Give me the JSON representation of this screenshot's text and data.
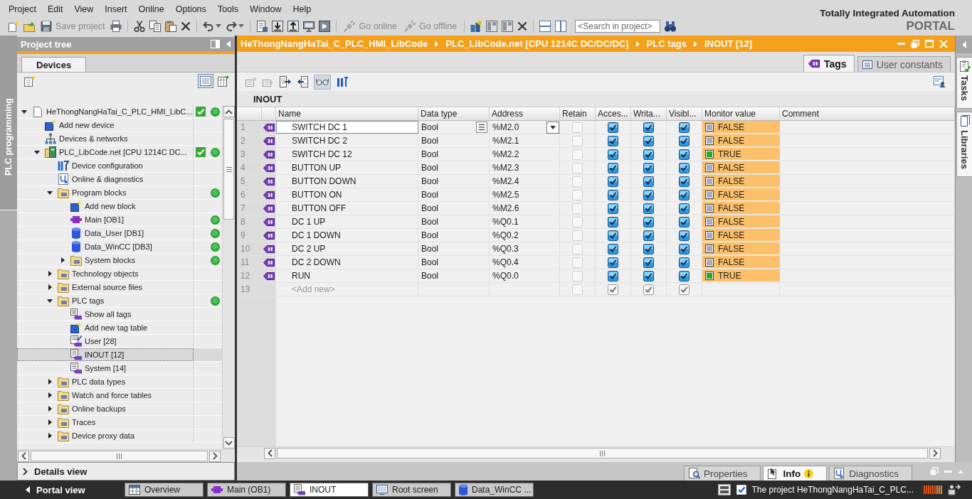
{
  "menu_bar": {
    "items": [
      "Project",
      "Edit",
      "View",
      "Insert",
      "Online",
      "Options",
      "Tools",
      "Window",
      "Help"
    ]
  },
  "toolbar": {
    "buttons": [
      {
        "label": "Save project",
        "disabled": true
      },
      {
        "label": "Go online",
        "disabled": true
      },
      {
        "label": "Go offline",
        "disabled": true
      }
    ],
    "search": {
      "placeholder": "<Search in project>"
    }
  },
  "branding": {
    "title": "Totally Integrated Automation",
    "product": "PORTAL"
  },
  "side_tab": {
    "label": "PLC programming"
  },
  "project_tree": {
    "title": "Project tree",
    "tabs": [
      {
        "label": "Devices",
        "selected": true
      }
    ],
    "toggle_pressed": true,
    "items": [
      {
        "label": "HeThongNangHaTai_C_PLC_HMI_LibC...",
        "kind": "project",
        "expanded": true,
        "consistent": true,
        "online_ok": true,
        "selected": false,
        "children": [
          {
            "label": "Add new device",
            "kind": "add",
            "consistent": false,
            "online_ok": false,
            "selected": false
          },
          {
            "label": "Devices & networks",
            "kind": "network",
            "consistent": false,
            "online_ok": false,
            "selected": false
          },
          {
            "label": "PLC_LibCode.net [CPU 1214C DC...",
            "kind": "plc",
            "expanded": true,
            "consistent": true,
            "online_ok": true,
            "selected": false,
            "children": [
              {
                "label": "Device configuration",
                "kind": "config",
                "consistent": false,
                "online_ok": false,
                "selected": false
              },
              {
                "label": "Online & diagnostics",
                "kind": "diagnostics",
                "consistent": false,
                "online_ok": false,
                "selected": false
              },
              {
                "label": "Program blocks",
                "kind": "folder",
                "expanded": true,
                "consistent": false,
                "online_ok": true,
                "selected": false,
                "children": [
                  {
                    "label": "Add new block",
                    "kind": "add",
                    "consistent": false,
                    "online_ok": false,
                    "selected": false
                  },
                  {
                    "label": "Main [OB1]",
                    "kind": "ob",
                    "consistent": false,
                    "online_ok": true,
                    "selected": false
                  },
                  {
                    "label": "Data_User [DB1]",
                    "kind": "db",
                    "consistent": false,
                    "online_ok": true,
                    "selected": false
                  },
                  {
                    "label": "Data_WinCC [DB3]",
                    "kind": "db",
                    "consistent": false,
                    "online_ok": true,
                    "selected": false
                  },
                  {
                    "label": "System blocks",
                    "kind": "folder",
                    "expanded": false,
                    "consistent": false,
                    "online_ok": true,
                    "selected": false
                  }
                ]
              },
              {
                "label": "Technology objects",
                "kind": "folder",
                "expanded": false,
                "consistent": false,
                "online_ok": false,
                "selected": false
              },
              {
                "label": "External source files",
                "kind": "folder",
                "expanded": false,
                "consistent": false,
                "online_ok": false,
                "selected": false
              },
              {
                "label": "PLC tags",
                "kind": "folder",
                "expanded": true,
                "consistent": false,
                "online_ok": true,
                "selected": false,
                "children": [
                  {
                    "label": "Show all tags",
                    "kind": "showtags",
                    "consistent": false,
                    "online_ok": false,
                    "selected": false
                  },
                  {
                    "label": "Add new tag table",
                    "kind": "add",
                    "consistent": false,
                    "online_ok": false,
                    "selected": false
                  },
                  {
                    "label": "User [28]",
                    "kind": "usertable",
                    "consistent": false,
                    "online_ok": false,
                    "selected": false
                  },
                  {
                    "label": "INOUT [12]",
                    "kind": "tagtable",
                    "consistent": false,
                    "online_ok": false,
                    "selected": true
                  },
                  {
                    "label": "System [14]",
                    "kind": "tagtable",
                    "consistent": false,
                    "online_ok": false,
                    "selected": false
                  }
                ]
              },
              {
                "label": "PLC data types",
                "kind": "folder",
                "expanded": false,
                "consistent": false,
                "online_ok": false,
                "selected": false
              },
              {
                "label": "Watch and force tables",
                "kind": "folder",
                "expanded": false,
                "consistent": false,
                "online_ok": false,
                "selected": false
              },
              {
                "label": "Online backups",
                "kind": "folder",
                "expanded": false,
                "consistent": false,
                "online_ok": false,
                "selected": false
              },
              {
                "label": "Traces",
                "kind": "folder",
                "expanded": false,
                "consistent": false,
                "online_ok": false,
                "selected": false
              },
              {
                "label": "Device proxy data",
                "kind": "folder",
                "expanded": false,
                "consistent": false,
                "online_ok": false,
                "selected": false
              }
            ]
          }
        ]
      }
    ]
  },
  "editor": {
    "breadcrumb": [
      "HeThongNangHaTai_C_PLC_HMI_LibCode",
      "PLC_LibCode.net [CPU 1214C DC/DC/DC]",
      "PLC tags",
      "INOUT [12]"
    ],
    "tabs": [
      {
        "label": "Tags",
        "kind": "tags",
        "selected": true
      },
      {
        "label": "User constants",
        "kind": "constants",
        "selected": false
      }
    ],
    "monitoring": true,
    "table_title": "INOUT",
    "columns": [
      "Name",
      "Data type",
      "Address",
      "Retain",
      "Acces...",
      "Writa...",
      "Visibl...",
      "Monitor value",
      "Comment"
    ],
    "rows": [
      {
        "number": "1",
        "name": "SWITCH DC 1",
        "data_type": "Bool",
        "address": "%M2.0",
        "retain": false,
        "accessible": true,
        "writable": true,
        "visible": true,
        "monitor_value": "FALSE",
        "signal": false,
        "focused": true
      },
      {
        "number": "2",
        "name": "SWITCH DC 2",
        "data_type": "Bool",
        "address": "%M2.1",
        "retain": false,
        "accessible": true,
        "writable": true,
        "visible": true,
        "monitor_value": "FALSE",
        "signal": false,
        "focused": false
      },
      {
        "number": "3",
        "name": "SWITCH DC 12",
        "data_type": "Bool",
        "address": "%M2.2",
        "retain": false,
        "accessible": true,
        "writable": true,
        "visible": true,
        "monitor_value": "TRUE",
        "signal": true,
        "focused": false
      },
      {
        "number": "4",
        "name": "BUTTON UP",
        "data_type": "Bool",
        "address": "%M2.3",
        "retain": false,
        "accessible": true,
        "writable": true,
        "visible": true,
        "monitor_value": "FALSE",
        "signal": false,
        "focused": false
      },
      {
        "number": "5",
        "name": "BUTTON DOWN",
        "data_type": "Bool",
        "address": "%M2.4",
        "retain": false,
        "accessible": true,
        "writable": true,
        "visible": true,
        "monitor_value": "FALSE",
        "signal": false,
        "focused": false
      },
      {
        "number": "6",
        "name": "BUTTON ON",
        "data_type": "Bool",
        "address": "%M2.5",
        "retain": false,
        "accessible": true,
        "writable": true,
        "visible": true,
        "monitor_value": "FALSE",
        "signal": false,
        "focused": false
      },
      {
        "number": "7",
        "name": "BUTTON OFF",
        "data_type": "Bool",
        "address": "%M2.6",
        "retain": false,
        "accessible": true,
        "writable": true,
        "visible": true,
        "monitor_value": "FALSE",
        "signal": false,
        "focused": false
      },
      {
        "number": "8",
        "name": "DC 1 UP",
        "data_type": "Bool",
        "address": "%Q0.1",
        "retain": false,
        "accessible": true,
        "writable": true,
        "visible": true,
        "monitor_value": "FALSE",
        "signal": false,
        "focused": false
      },
      {
        "number": "9",
        "name": "DC 1 DOWN",
        "data_type": "Bool",
        "address": "%Q0.2",
        "retain": false,
        "accessible": true,
        "writable": true,
        "visible": true,
        "monitor_value": "FALSE",
        "signal": false,
        "focused": false
      },
      {
        "number": "10",
        "name": "DC 2 UP",
        "data_type": "Bool",
        "address": "%Q0.3",
        "retain": false,
        "accessible": true,
        "writable": true,
        "visible": true,
        "monitor_value": "FALSE",
        "signal": false,
        "focused": false
      },
      {
        "number": "11",
        "name": "DC 2 DOWN",
        "data_type": "Bool",
        "address": "%Q0.4",
        "retain": false,
        "accessible": true,
        "writable": true,
        "visible": true,
        "monitor_value": "FALSE",
        "signal": false,
        "focused": false
      },
      {
        "number": "12",
        "name": "RUN",
        "data_type": "Bool",
        "address": "%Q0.0",
        "retain": false,
        "accessible": true,
        "writable": true,
        "visible": true,
        "monitor_value": "TRUE",
        "signal": true,
        "focused": false
      }
    ],
    "new_row": {
      "number": "13",
      "placeholder": "<Add new>",
      "retain": false,
      "accessible": true,
      "writable": true,
      "visible": true
    }
  },
  "right_tabs": [
    {
      "label": "Tasks",
      "kind": "tasks"
    },
    {
      "label": "Libraries",
      "kind": "libraries"
    }
  ],
  "details_view": {
    "label": "Details view",
    "expanded": false
  },
  "inspector_tabs": [
    {
      "label": "Properties",
      "kind": "properties",
      "selected": false
    },
    {
      "label": "Info",
      "kind": "info",
      "selected": true
    },
    {
      "label": "Diagnostics",
      "kind": "diagnostics",
      "selected": false
    }
  ],
  "taskbar": {
    "portal_label": "Portal view",
    "tabs": [
      {
        "label": "Overview",
        "kind": "overview",
        "selected": false
      },
      {
        "label": "Main (OB1)",
        "kind": "ob",
        "selected": false
      },
      {
        "label": "INOUT",
        "kind": "tagtable",
        "selected": true
      },
      {
        "label": "Root screen",
        "kind": "screen",
        "selected": false
      },
      {
        "label": "Data_WinCC ...",
        "kind": "db",
        "selected": false
      }
    ],
    "status_message": "The project HeThongNangHaTai_C_PLC..."
  }
}
